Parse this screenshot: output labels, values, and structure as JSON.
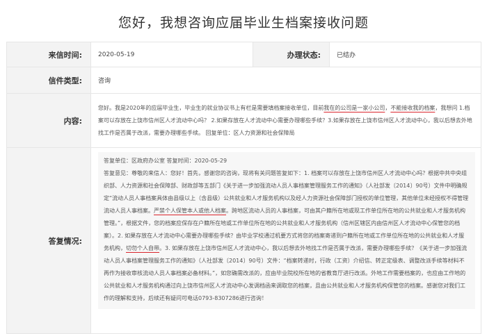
{
  "page_title": "您好，我想咨询应届毕业生档案接收问题",
  "fields": {
    "date_label": "来信时间:",
    "date_value": "2020-05-19",
    "status_label": "办理状态:",
    "status_value": "已结办",
    "type_label": "信件类型:",
    "type_value": "咨询",
    "content_label": "内容:",
    "reply_label": "答复情况:"
  },
  "content": {
    "p1": "您好。我是2020年的应届毕业生，毕业生的就业协议书上有栏是需要填档案接收单位，目前",
    "hl1": "我在的公司是一家小公司",
    "p2": "，",
    "hl2": "不能接收我的档案",
    "p3": "，我想问 1.档案可以存放在上饶市信州区人才流动中心吗？ 2.如果存放在人才流动中心需要办理哪些手续？3.如果存放在上饶市信州区人才流动中心，我以后想去外地找工作是否属于改派，需要办理哪些手续。 回复单位：区人力资源和社会保障局"
  },
  "reply": {
    "unit_line": "答复单位：区政府办公室   答复时间：2020-05-29",
    "r1": "答复意见：尊敬的来信人：您好！首先，感谢您的咨询，现将有关问题答复如下：1. 档案可以存放在上饶市信州区人才流动中心吗？根据中共中央组织部、人力资源和社会保障部、财政部等五部门《关于进一步加强流动人员人事档案管理服务工作的通知》（人社部发〔2014〕90号）文件中明确规定“流动人员人事档案具体由县级以上（含县级）公共就业和人才服务机构以及经人力资源社会保障部门授权的单位管理，其他单位未经授权不得管理流动人员人事档案。",
    "hl1": "严禁个人保管本人或他人档案",
    "r2": "。跨地区流动人员的人事档案，可由其户籍所在地或现工作单位所在地的公共就业和人才服务机构管理。”，根据文件，您的档案应保存在户籍所在地或工作单位所在地的公共就业和人才服务机构（信州区辖区内由信州区人才流动中心保管您的档案）。2. 如果存放在人才流动中心需要办理哪些手续？由毕业学校通过机要方式将您的档案寄递到户籍所在地或工作单位所在地的公共就业和人才服务机构，",
    "hl2": "切勿个人自带",
    "r3": "。3. 如果存放在上饶市信州区人才流动中心，我以后想去外地找工作是否属于改派，需要办理哪些手续？《关于进一步加强流动人员人事档案管理服务工作的通知》（人社部发〔2014〕90号）文件：“档案转递时，行政（工资）介绍信、转正定级表、调整改派手续等材料不再作为接收审核流动人员人事档案必备材料。”，如您确需改派的，应由毕业院校所在地的省教育厅进行改派。外地工作需要档案的，也应由工作地的公共就业和人才服务机构通过向上饶市信州区人才流动中心发调档函来调取您的档案，且由公共就业和人才服务机构保管您的档案。感谢您对我们工作的理解和支持，后续还有疑问可电话0793-8307286进行咨询！"
  }
}
